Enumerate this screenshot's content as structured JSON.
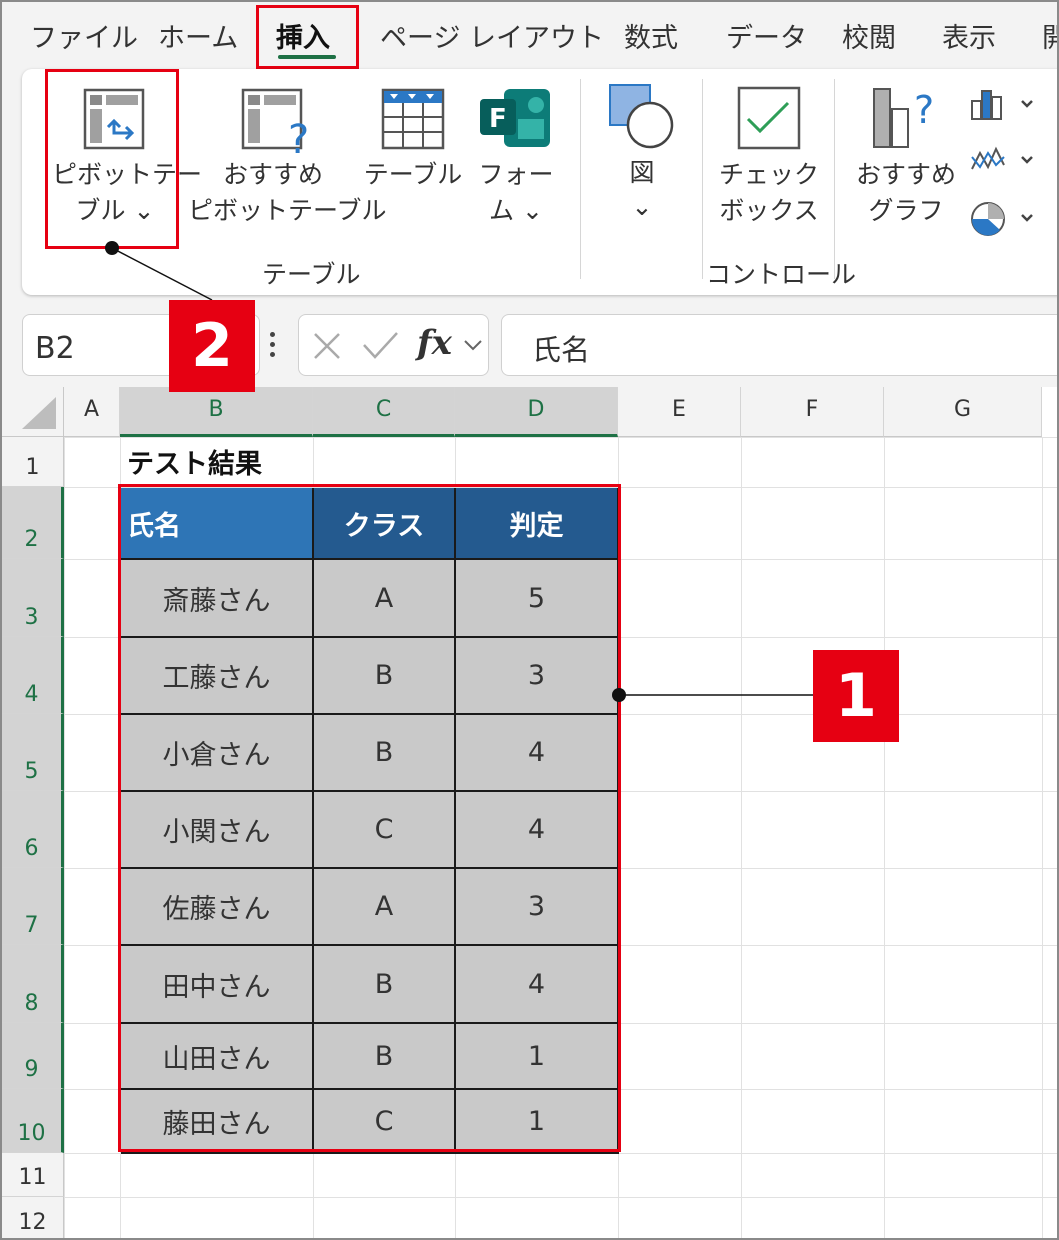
{
  "tabs": [
    {
      "label": "ファイル",
      "active": false
    },
    {
      "label": "ホーム",
      "active": false
    },
    {
      "label": "挿入",
      "active": true
    },
    {
      "label": "ページ レイアウト",
      "active": false
    },
    {
      "label": "数式",
      "active": false
    },
    {
      "label": "データ",
      "active": false
    },
    {
      "label": "校閲",
      "active": false
    },
    {
      "label": "表示",
      "active": false
    },
    {
      "label": "開",
      "active": false
    }
  ],
  "ribbon": {
    "pivot_line1": "ピボットテー",
    "pivot_line2": "ブル ⌄",
    "recommended_pivot_line1": "おすすめ",
    "recommended_pivot_line2": "ピボットテーブル",
    "table": "テーブル",
    "forms_line1": "フォー",
    "forms_line2": "ム ⌄",
    "shapes_line1": "図",
    "shapes_line2": "⌄",
    "checkbox_line1": "チェック",
    "checkbox_line2": "ボックス",
    "recommended_chart_line1": "おすすめ",
    "recommended_chart_line2": "グラフ",
    "group_table": "テーブル",
    "group_control": "コントロール"
  },
  "formula_bar": {
    "name_box": "B2",
    "formula": "氏名",
    "fx": "fx"
  },
  "columns": [
    "A",
    "B",
    "C",
    "D",
    "E",
    "F",
    "G"
  ],
  "rows": [
    "1",
    "2",
    "3",
    "4",
    "5",
    "6",
    "7",
    "8",
    "9",
    "10",
    "11",
    "12"
  ],
  "sheet": {
    "title": "テスト結果",
    "headers": [
      "氏名",
      "クラス",
      "判定"
    ],
    "data": [
      [
        "斎藤さん",
        "A",
        "5"
      ],
      [
        "工藤さん",
        "B",
        "3"
      ],
      [
        "小倉さん",
        "B",
        "4"
      ],
      [
        "小関さん",
        "C",
        "4"
      ],
      [
        "佐藤さん",
        "A",
        "3"
      ],
      [
        "田中さん",
        "B",
        "4"
      ],
      [
        "山田さん",
        "B",
        "1"
      ],
      [
        "藤田さん",
        "C",
        "1"
      ]
    ]
  },
  "callouts": {
    "one": "1",
    "two": "2"
  },
  "colors": {
    "header_blue": "#2e75b6",
    "header_dark": "#245a8f",
    "selection": "#c9c9c9",
    "accent_green": "#1e7145",
    "callout_red": "#e60012"
  }
}
